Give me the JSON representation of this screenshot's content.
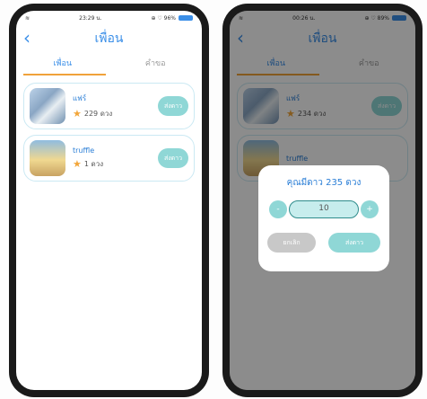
{
  "left_phone": {
    "status": {
      "time": "23:29 น.",
      "icons_text": "⊕ ♡ 96%"
    },
    "header": {
      "title": "เพื่อน"
    },
    "tabs": [
      {
        "label": "เพื่อน"
      },
      {
        "label": "คำขอ"
      }
    ],
    "friends": [
      {
        "name": "แฟร์",
        "stars": "229 ดวง",
        "action": "ส่งดาว"
      },
      {
        "name": "truffle",
        "stars": "1 ดวง",
        "action": "ส่งดาว"
      }
    ]
  },
  "right_phone": {
    "status": {
      "time": "00:26 น.",
      "icons_text": "⊕ ♡ 89%"
    },
    "header": {
      "title": "เพื่อน"
    },
    "tabs": [
      {
        "label": "เพื่อน"
      },
      {
        "label": "คำขอ"
      }
    ],
    "friends": [
      {
        "name": "แฟร์",
        "stars": "234 ดวง",
        "action": "ส่งดาว"
      },
      {
        "name": "truffle",
        "stars": "",
        "action": ""
      }
    ],
    "modal": {
      "title": "คุณมีดาว 235 ดวง",
      "minus": "-",
      "quantity": "10",
      "plus": "+",
      "cancel": "ยกเลิก",
      "confirm": "ส่งดาว"
    }
  },
  "colors": {
    "accent": "#3b8fe8",
    "teal": "#8fd7d6",
    "tab_underline": "#f0a23a",
    "star": "#f2a63a"
  }
}
